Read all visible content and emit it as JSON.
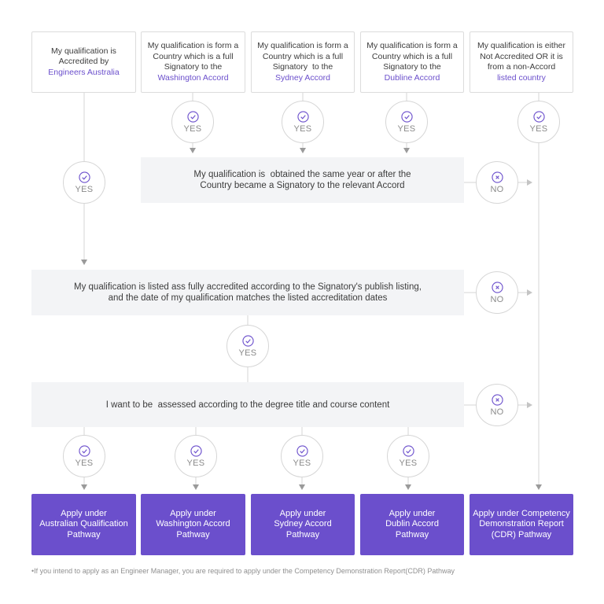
{
  "colors": {
    "accent": "#6b4fcc",
    "question_bg": "#f3f4f6",
    "connector": "#d6d6d6",
    "arrow": "#9a9a9a",
    "label": "#8a8a8a"
  },
  "start_boxes": [
    {
      "lines": [
        "My qualification is",
        "Accredited by"
      ],
      "highlight": "Engineers Australia"
    },
    {
      "lines": [
        "My qualification is form a",
        "Country which is a full",
        "Signatory to the"
      ],
      "highlight": "Washington Accord"
    },
    {
      "lines": [
        "My qualification is form a",
        "Country which is a full",
        "Signatory  to the"
      ],
      "highlight": "Sydney Accord"
    },
    {
      "lines": [
        "My qualification is form a",
        "Country which is a full",
        "Signatory to the"
      ],
      "highlight": "Dubline Accord"
    },
    {
      "lines": [
        "My qualification is either",
        "Not Accredited OR it is",
        "from a non-Accord"
      ],
      "highlight": "listed country"
    }
  ],
  "questions": [
    {
      "lines": [
        "My qualification is  obtained the same year or after the",
        "Country became a Signatory to the relevant Accord"
      ]
    },
    {
      "lines": [
        "My qualification is listed ass fully accredited according to the Signatory's publish listing,",
        "and the date of my qualification matches the listed accreditation dates"
      ]
    },
    {
      "lines": [
        "I want to be  assessed according to the degree title and course content"
      ]
    }
  ],
  "answers": {
    "yes": {
      "label": "YES",
      "icon": "check-circle-icon"
    },
    "no": {
      "label": "NO",
      "icon": "x-circle-icon"
    }
  },
  "outcomes": [
    {
      "lines": [
        "Apply under",
        "Australian Qualification",
        "Pathway"
      ]
    },
    {
      "lines": [
        "Apply under",
        "Washington Accord",
        "Pathway"
      ]
    },
    {
      "lines": [
        "Apply under",
        "Sydney Accord",
        "Pathway"
      ]
    },
    {
      "lines": [
        "Apply under",
        "Dublin Accord",
        "Pathway"
      ]
    },
    {
      "lines": [
        "Apply under Competency",
        "Demonstration Report",
        "(CDR) Pathway"
      ]
    }
  ],
  "footnote": "•If you intend to apply as an Engineer Manager, you are required to apply under the Competency Demonstration Report(CDR) Pathway"
}
